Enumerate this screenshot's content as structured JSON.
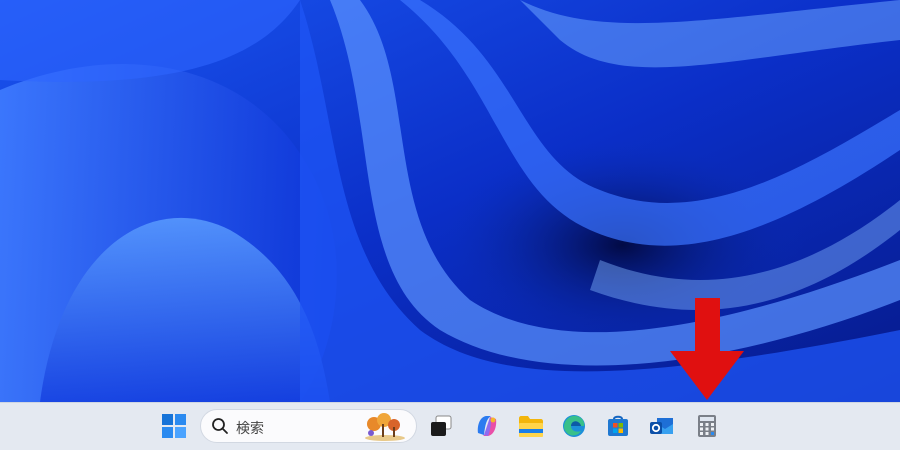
{
  "search": {
    "placeholder": "検索"
  },
  "taskbar": {
    "items": [
      {
        "name": "start-button"
      },
      {
        "name": "search-box"
      },
      {
        "name": "task-view-button"
      },
      {
        "name": "copilot-button"
      },
      {
        "name": "file-explorer-button"
      },
      {
        "name": "edge-browser-button"
      },
      {
        "name": "microsoft-store-button"
      },
      {
        "name": "outlook-button"
      },
      {
        "name": "calculator-button"
      }
    ]
  },
  "annotation": {
    "arrow_color": "#e01010",
    "points_to": "calculator-button"
  },
  "colors": {
    "taskbar_bg": "#e4e9f1",
    "wallpaper_base": "#0a2fd0"
  }
}
